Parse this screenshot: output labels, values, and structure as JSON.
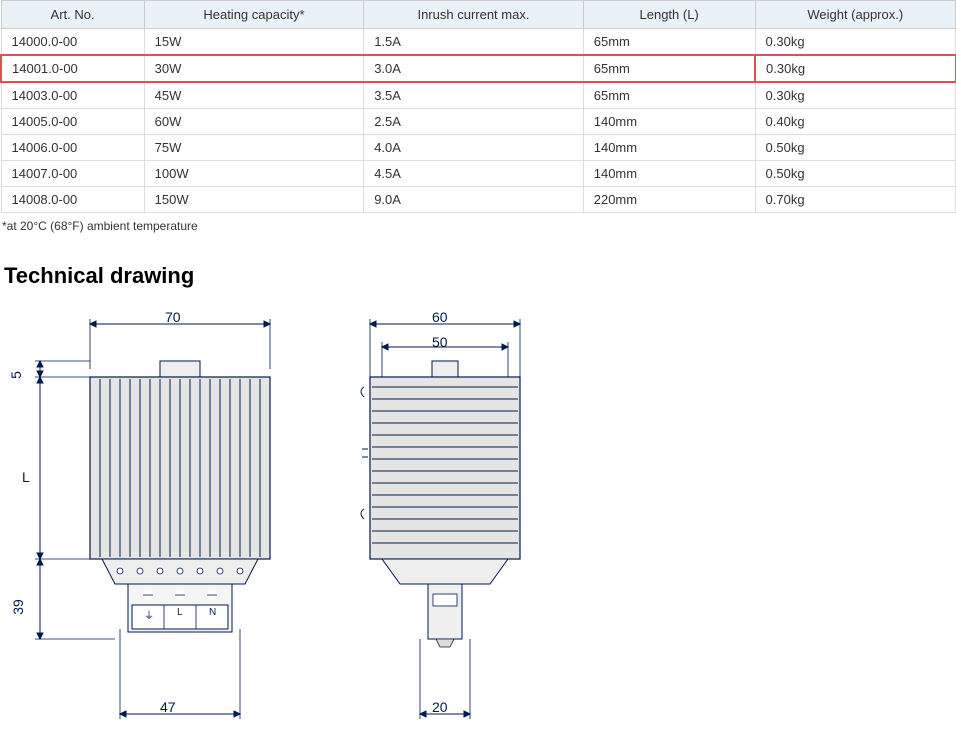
{
  "table": {
    "headers": [
      "Art. No.",
      "Heating capacity*",
      "Inrush current max.",
      "Length (L)",
      "Weight (approx.)"
    ],
    "rows": [
      {
        "art": "14000.0-00",
        "cap": "15W",
        "inr": "1.5A",
        "len": "65mm",
        "wt": "0.30kg",
        "hl": false
      },
      {
        "art": "14001.0-00",
        "cap": "30W",
        "inr": "3.0A",
        "len": "65mm",
        "wt": "0.30kg",
        "hl": true
      },
      {
        "art": "14003.0-00",
        "cap": "45W",
        "inr": "3.5A",
        "len": "65mm",
        "wt": "0.30kg",
        "hl": false
      },
      {
        "art": "14005.0-00",
        "cap": "60W",
        "inr": "2.5A",
        "len": "140mm",
        "wt": "0.40kg",
        "hl": false
      },
      {
        "art": "14006.0-00",
        "cap": "75W",
        "inr": "4.0A",
        "len": "140mm",
        "wt": "0.50kg",
        "hl": false
      },
      {
        "art": "14007.0-00",
        "cap": "100W",
        "inr": "4.5A",
        "len": "140mm",
        "wt": "0.50kg",
        "hl": false
      },
      {
        "art": "14008.0-00",
        "cap": "150W",
        "inr": "9.0A",
        "len": "220mm",
        "wt": "0.70kg",
        "hl": false
      }
    ],
    "footnote": "*at 20°C (68°F) ambient temperature"
  },
  "section_title": "Technical drawing",
  "drawing": {
    "front": {
      "dim_top": "70",
      "dim_left_top": "5",
      "dim_left_mid": "L",
      "dim_left_bot": "39",
      "dim_bot": "47",
      "terminal_labels": [
        "⏚",
        "L",
        "N"
      ]
    },
    "side": {
      "dim_top_outer": "60",
      "dim_top_inner": "50",
      "dim_bot": "20"
    }
  }
}
